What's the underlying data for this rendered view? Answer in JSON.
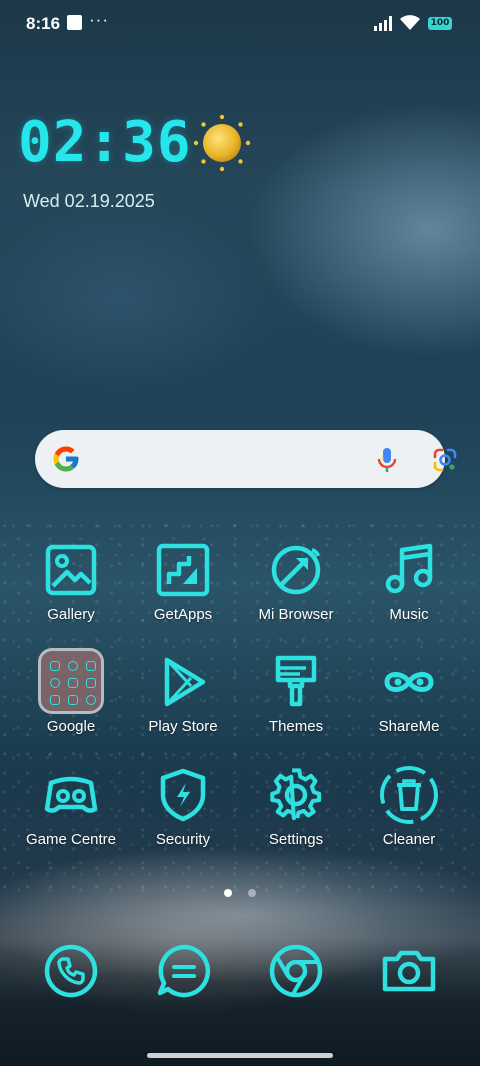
{
  "status_bar": {
    "time": "8:16",
    "more_indicator": "···",
    "battery": "100",
    "icons": [
      "notification-square-icon",
      "signal-icon",
      "wifi-icon",
      "battery-icon"
    ]
  },
  "clock_widget": {
    "time": "02:36",
    "date": "Wed 02.19.2025",
    "weather_icon": "sun-icon",
    "accent_color": "#25e6ea"
  },
  "search_bar": {
    "icons": [
      "google-g-icon",
      "microphone-icon",
      "google-lens-icon"
    ]
  },
  "apps": [
    {
      "label": "Gallery",
      "icon": "gallery-icon"
    },
    {
      "label": "GetApps",
      "icon": "getapps-icon"
    },
    {
      "label": "Mi Browser",
      "icon": "browser-icon"
    },
    {
      "label": "Music",
      "icon": "music-icon"
    },
    {
      "label": "Google",
      "icon": "folder-icon"
    },
    {
      "label": "Play Store",
      "icon": "play-store-icon"
    },
    {
      "label": "Themes",
      "icon": "themes-icon"
    },
    {
      "label": "ShareMe",
      "icon": "shareme-icon"
    },
    {
      "label": "Game Centre",
      "icon": "game-centre-icon"
    },
    {
      "label": "Security",
      "icon": "security-icon"
    },
    {
      "label": "Settings",
      "icon": "settings-icon"
    },
    {
      "label": "Cleaner",
      "icon": "cleaner-icon"
    }
  ],
  "pager": {
    "pages": 2,
    "current": 1
  },
  "dock": [
    "phone-icon",
    "messages-icon",
    "chrome-icon",
    "camera-icon"
  ]
}
